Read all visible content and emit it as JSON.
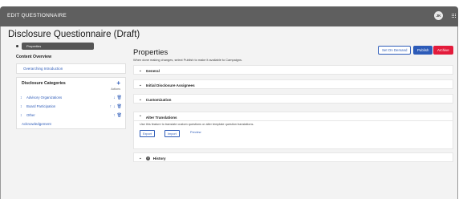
{
  "app": {
    "title": "EDIT QUESTIONNAIRE",
    "avatar_initials": "JK"
  },
  "page": {
    "title": "Disclosure Questionnaire (Draft)",
    "tag": "Properties"
  },
  "sidebar": {
    "overview": {
      "heading": "Content Overview",
      "link": "Overarching Introduction"
    },
    "categories": {
      "heading": "Disclosure Categories",
      "actions_label": "Actions",
      "items": [
        {
          "label": "Advisory Organizations"
        },
        {
          "label": "Board Participation"
        },
        {
          "label": "Other"
        }
      ],
      "footer_link": "Acknowledgement"
    }
  },
  "main": {
    "title": "Properties",
    "subtitle": "When done making changes, select Publish to make it available to Campaigns.",
    "buttons": {
      "on_demand": "Set On Demand",
      "publish": "Publish",
      "archive": "Archive"
    },
    "sections": {
      "general": "General",
      "initial_assignees": "Initial Disclosure Assignees",
      "customization": "Customization",
      "alter_translations": "Alter Translations",
      "history": "History"
    },
    "alter": {
      "description": "Use this feature to translate custom questions or alter template question translations.",
      "export": "Export",
      "import": "Import",
      "preview": "Preview"
    }
  },
  "colors": {
    "accent": "#2d5bb8",
    "danger": "#e31b3b",
    "titlebar": "#5f5f5f"
  }
}
